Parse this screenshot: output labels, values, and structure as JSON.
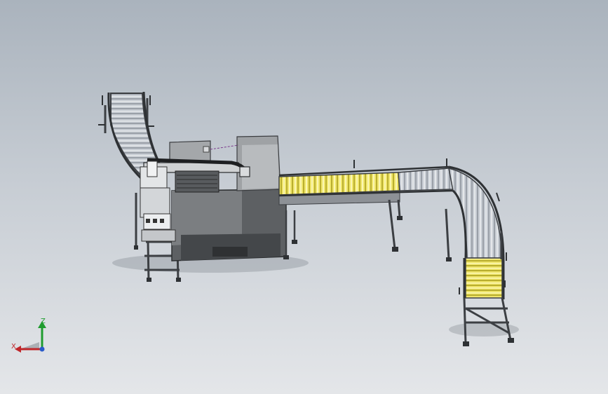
{
  "view": {
    "background_top": "#aab3bd",
    "background_bottom": "#e4e6e9"
  },
  "model": {
    "roller_color": "#c7ccd3",
    "highlight_color": "#efe56a",
    "frame_color": "#3c3f43",
    "machine_color": "#8b8e91",
    "machine_dark": "#4a4c4f"
  },
  "triad": {
    "z_label": "Z",
    "x_label": "X",
    "z_color": "#1f9c2f",
    "x_color": "#c0262a"
  }
}
